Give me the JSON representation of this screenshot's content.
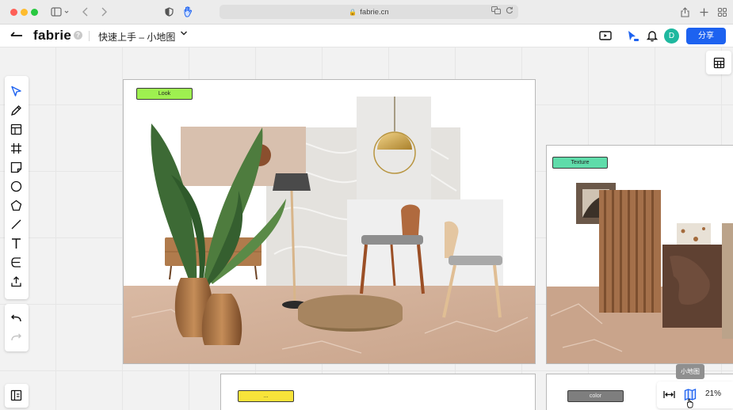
{
  "browser": {
    "url": "fabrie.cn"
  },
  "app": {
    "logo": "fabrie",
    "help": "?",
    "doc_title": "快速上手 – 小地图",
    "avatar_initial": "D",
    "share_label": "分享"
  },
  "canvas": {
    "frames": {
      "look": {
        "tag": "Look",
        "tag_color": "#9ef050"
      },
      "texture": {
        "tag": "Texture",
        "tag_color": "#5fdcaa"
      },
      "third": {
        "tag": "...",
        "tag_color": "#f7e33a"
      },
      "color": {
        "tag": "color",
        "tag_color": "#7e7e7e"
      }
    }
  },
  "toolbar": {
    "tools": [
      "select-icon",
      "pen-icon",
      "template-icon",
      "frame-icon",
      "sticky-note-icon",
      "circle-icon",
      "polygon-icon",
      "line-icon",
      "text-icon",
      "connector-icon",
      "upload-icon"
    ],
    "history": [
      "undo-icon",
      "redo-icon"
    ]
  },
  "zoom": {
    "tooltip": "小地图",
    "value": "21%"
  },
  "colors": {
    "accent": "#1d62f0",
    "avatar": "#1fb89f"
  }
}
